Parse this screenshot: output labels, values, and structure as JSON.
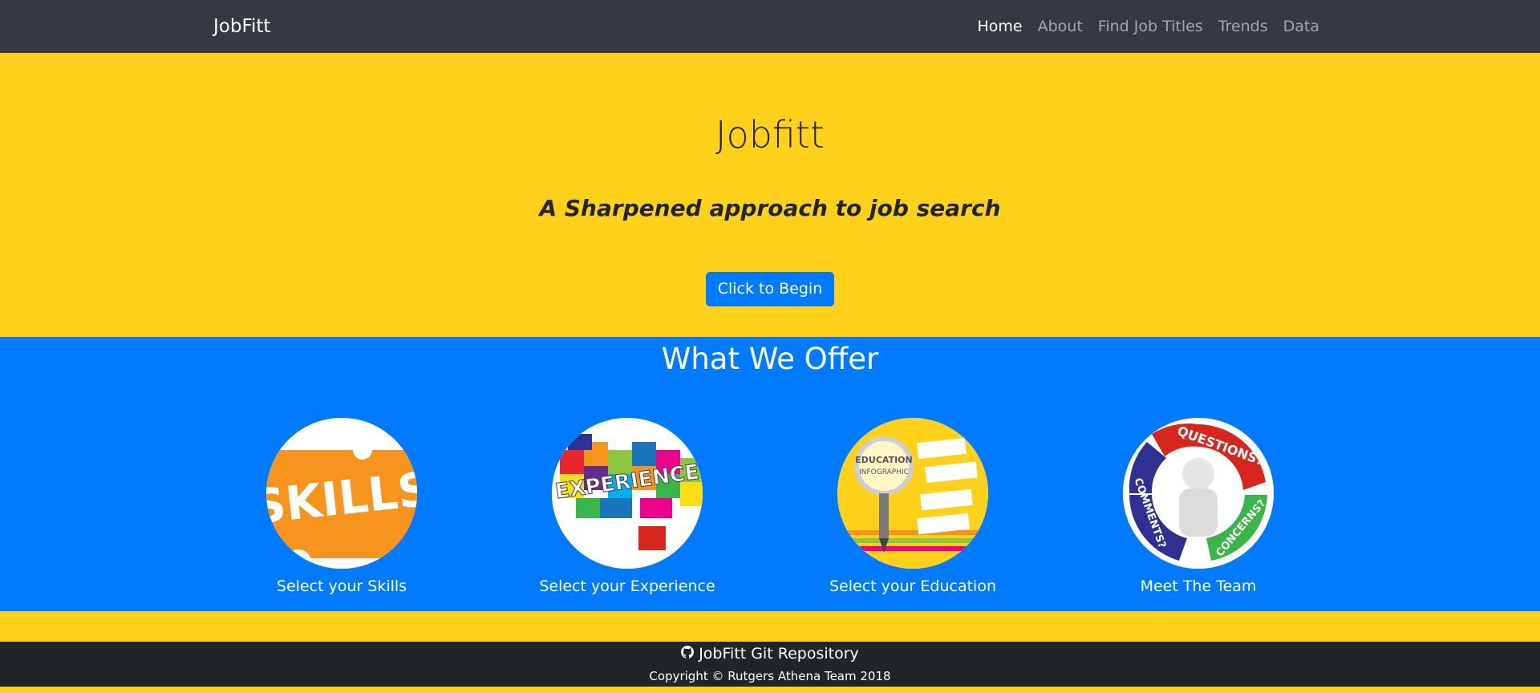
{
  "navbar": {
    "brand": "JobFitt",
    "links": [
      "Home",
      "About",
      "Find Job Titles",
      "Trends",
      "Data"
    ],
    "active": "Home"
  },
  "hero": {
    "title": "Jobfitt",
    "subtitle": "A Sharpened approach to job search",
    "button": "Click to Begin"
  },
  "offer": {
    "title": "What We Offer",
    "cards": [
      {
        "label": "Select your Skills",
        "image_text": "SKILLS",
        "image": "skills-puzzle-image"
      },
      {
        "label": "Select your Experience",
        "image_text": "EXPERIENCE",
        "image": "experience-puzzle-image"
      },
      {
        "label": "Select your Education",
        "image_text": "EDUCATION INFOGRAPHIC",
        "image": "education-infographic-image"
      },
      {
        "label": "Meet The Team",
        "image_text": "QUESTIONS? COMMENTS? CONCERNS?",
        "image": "questions-figure-image"
      }
    ]
  },
  "footer": {
    "repo_link": "JobFitt Git Repository",
    "repo_icon": "github-icon",
    "copyright": "Copyright © Rutgers Athena Team 2018"
  },
  "colors": {
    "navbar": "#343a40",
    "yellow": "#ffd11a",
    "blue": "#007bff",
    "footer": "#212529"
  }
}
